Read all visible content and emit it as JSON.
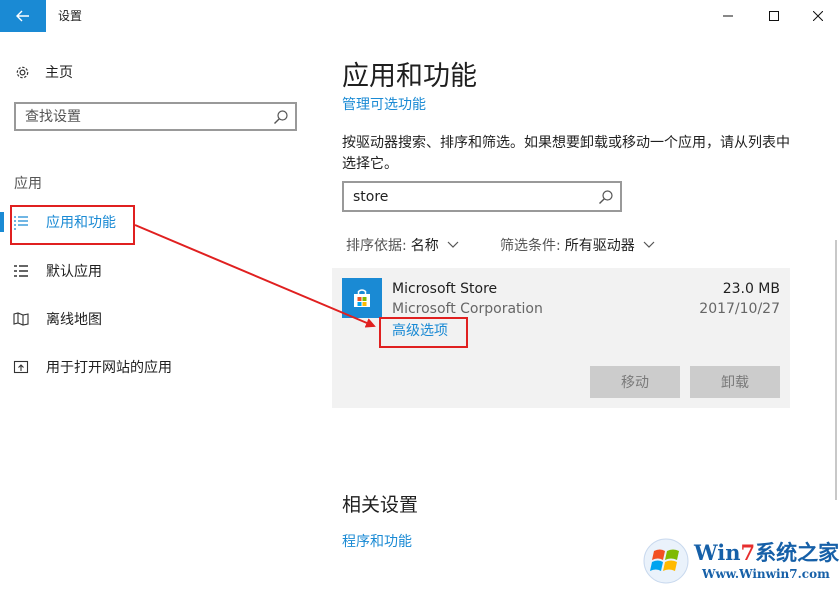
{
  "window": {
    "title": "设置"
  },
  "sidebar": {
    "home_label": "主页",
    "search_placeholder": "查找设置",
    "section_label": "应用",
    "items": [
      {
        "label": "应用和功能",
        "active": true
      },
      {
        "label": "默认应用",
        "active": false
      },
      {
        "label": "离线地图",
        "active": false
      },
      {
        "label": "用于打开网站的应用",
        "active": false
      }
    ]
  },
  "main": {
    "title": "应用和功能",
    "manage_optional_link": "管理可选功能",
    "description": "按驱动器搜索、排序和筛选。如果想要卸载或移动一个应用，请从列表中选择它。",
    "search_value": "store",
    "sort": {
      "label": "排序依据:",
      "value": "名称"
    },
    "filter": {
      "label": "筛选条件:",
      "value": "所有驱动器"
    },
    "app": {
      "name": "Microsoft Store",
      "publisher": "Microsoft Corporation",
      "size": "23.0 MB",
      "date": "2017/10/27",
      "advanced_link": "高级选项",
      "move_button": "移动",
      "uninstall_button": "卸载"
    },
    "related": {
      "title": "相关设置",
      "programs_link": "程序和功能"
    }
  },
  "watermark": {
    "brand_prefix": "Win",
    "brand_seven": "7",
    "brand_suffix": "系统之家",
    "url": "Www.Winwin7.com"
  },
  "colors": {
    "accent": "#1a8ad4",
    "highlight": "#e02020",
    "card_bg": "#f2f2f2",
    "disabled_button": "#cccccc"
  }
}
